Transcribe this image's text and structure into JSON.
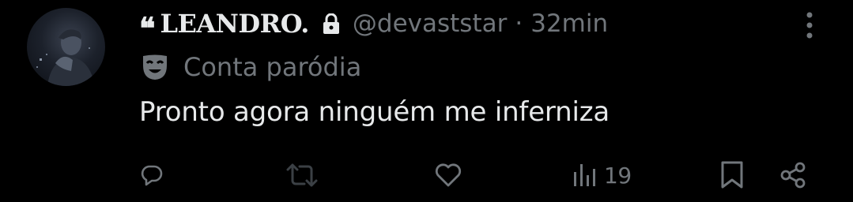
{
  "author": {
    "display_name": "LEANDRO.",
    "name_prefix_glyph": "❝",
    "handle": "@devaststar",
    "separator": "·",
    "time": "32min",
    "parody_label": "Conta paródia"
  },
  "tweet": {
    "text": "Pronto agora ninguém me inferniza"
  },
  "actions": {
    "views_count": "19"
  },
  "icons": {
    "lock": "lock-icon",
    "more": "more-options-icon",
    "parody": "theater-mask-icon",
    "reply": "reply-icon",
    "retweet": "retweet-icon",
    "like": "heart-icon",
    "views": "views-bar-chart-icon",
    "bookmark": "bookmark-icon",
    "share": "share-icon"
  },
  "colors": {
    "background": "#000000",
    "primary_text": "#e7e9ea",
    "secondary_text": "#71767b",
    "icon": "#71767b",
    "retweet_icon": "#3b4045"
  }
}
